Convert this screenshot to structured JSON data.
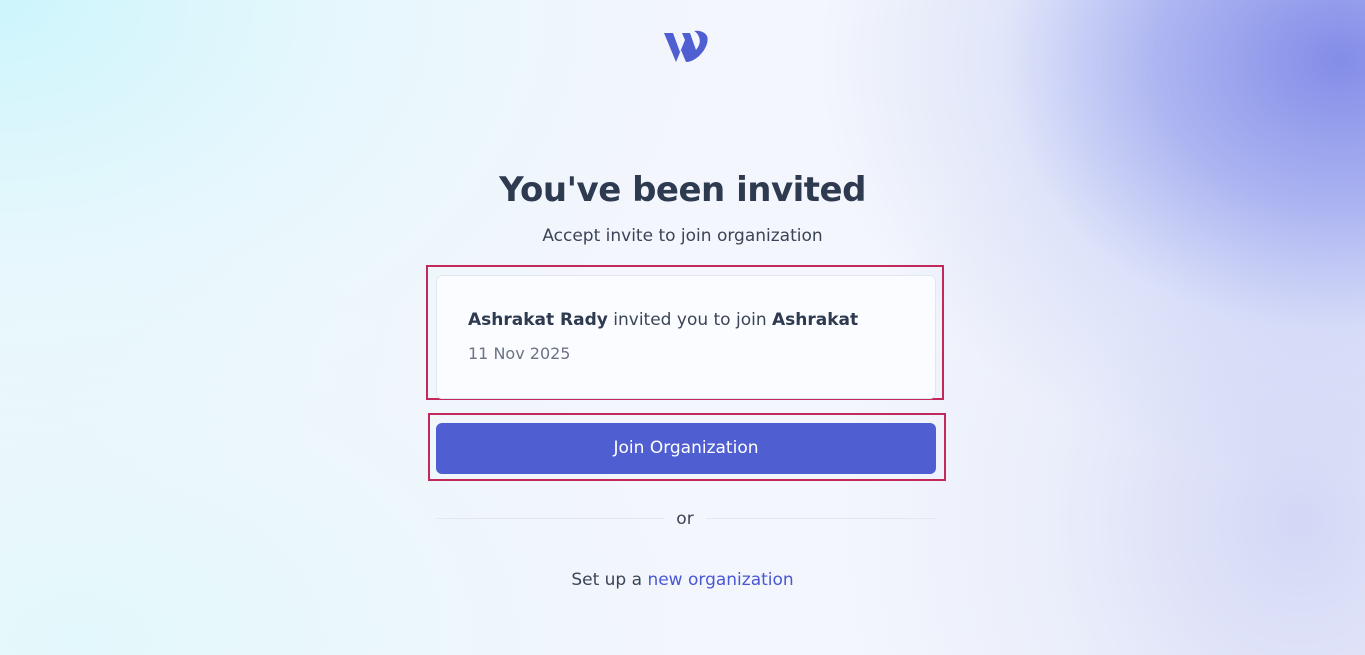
{
  "logo": {
    "icon": "brand-w-logo-icon",
    "color": "#4f5fd2"
  },
  "header": {
    "title": "You've been invited",
    "subtitle": "Accept invite to join organization"
  },
  "invite": {
    "inviter": "Ashrakat Rady",
    "middle_text": " invited you to join ",
    "organization": "Ashrakat",
    "date": "11 Nov 2025"
  },
  "actions": {
    "join_label": "Join Organization",
    "join_color": "#4f5fd2",
    "or_label": "or",
    "setup_prefix": "Set up a ",
    "setup_link": "new organization"
  },
  "highlight_color": "#c2285a"
}
